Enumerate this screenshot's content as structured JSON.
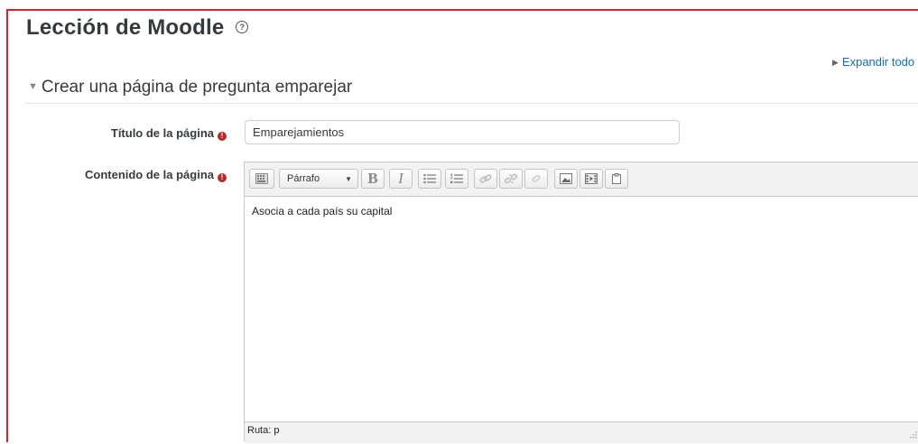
{
  "page": {
    "title": "Lección de Moodle"
  },
  "expand_all": "Expandir todo",
  "section": {
    "title": "Crear una página de pregunta emparejar"
  },
  "fields": {
    "title_label": "Título de la página",
    "title_value": "Emparejamientos",
    "content_label": "Contenido de la página"
  },
  "editor": {
    "format_select": "Párrafo",
    "bold": "B",
    "italic": "I",
    "content": "Asocia a cada país su capital",
    "path": "Ruta: p"
  },
  "colors": {
    "accent": "#0f6cbf",
    "required": "#b52b27",
    "frame": "#e51c23"
  }
}
